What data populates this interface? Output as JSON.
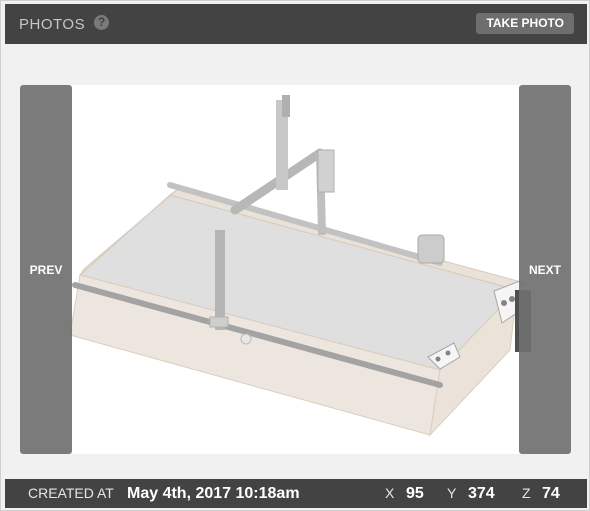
{
  "header": {
    "title": "PHOTOS",
    "help_icon": "?",
    "take_photo_label": "TAKE PHOTO"
  },
  "photo": {
    "prev_label": "PREV",
    "next_label": "NEXT"
  },
  "footer": {
    "created_label": "CREATED AT",
    "created_value": "May 4th, 2017 10:18am",
    "x_label": "X",
    "x_value": "95",
    "y_label": "Y",
    "y_value": "374",
    "z_label": "Z",
    "z_value": "74"
  },
  "colors": {
    "header_bg": "#434343",
    "panel_bg": "#f1f1f1",
    "nav_bg": "#707070"
  }
}
